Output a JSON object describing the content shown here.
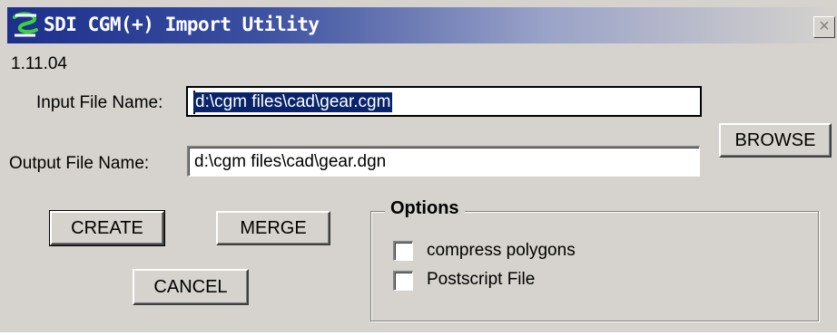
{
  "window": {
    "title": "SDI CGM(+) Import Utility",
    "close_glyph": "×",
    "version": "1.11.04"
  },
  "input_file": {
    "label": "Input File Name:",
    "value": "d:\\cgm files\\cad\\gear.cgm"
  },
  "output_file": {
    "label": "Output File Name:",
    "value": "d:\\cgm files\\cad\\gear.dgn"
  },
  "buttons": {
    "browse": "BROWSE",
    "create": "CREATE",
    "merge": "MERGE",
    "cancel": "CANCEL"
  },
  "options": {
    "title": "Options",
    "items": [
      {
        "label": "compress polygons",
        "checked": false
      },
      {
        "label": "Postscript File",
        "checked": false
      }
    ]
  },
  "colors": {
    "titlebar_start": "#1c2f8c",
    "titlebar_end": "#d6d3ce",
    "selection": "#0a246a",
    "face": "#d6d3ce"
  },
  "icons": {
    "app": "sdi-logo-icon",
    "close": "close-icon"
  }
}
